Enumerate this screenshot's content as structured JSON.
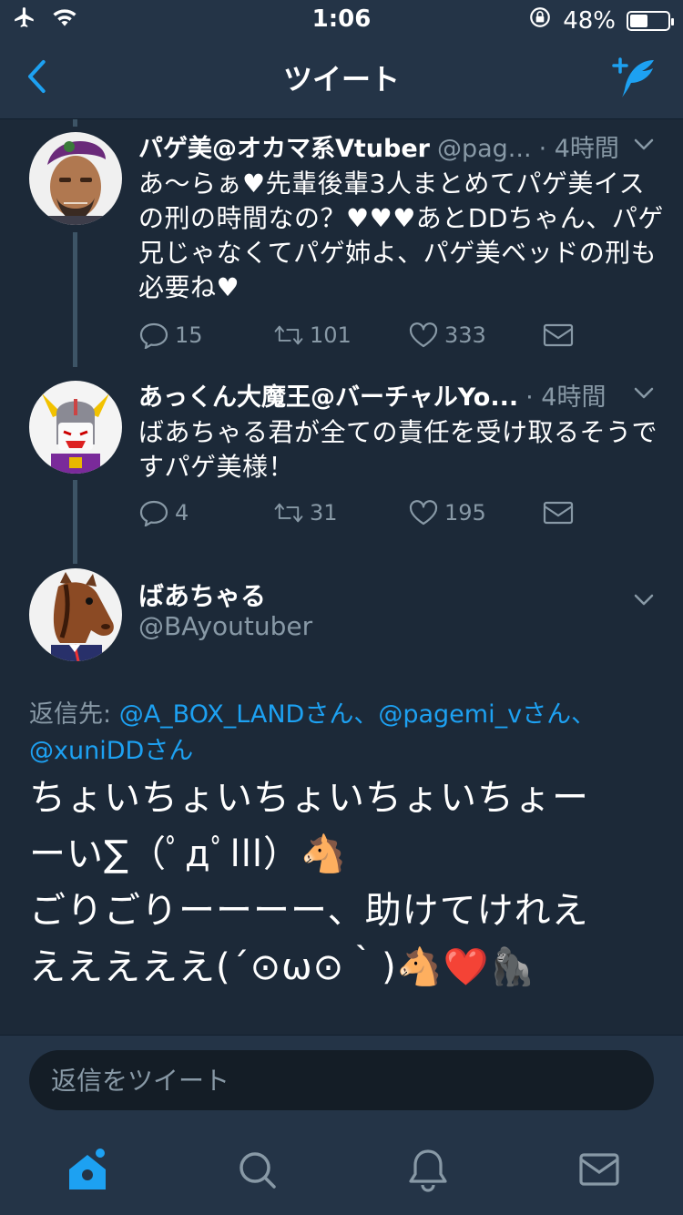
{
  "status_bar": {
    "time": "1:06",
    "battery": "48%",
    "battery_level": 0.48
  },
  "nav": {
    "title": "ツイート"
  },
  "tweets": [
    {
      "name": "パゲ美@オカマ系Vtuber",
      "handle": "@pag...",
      "time": "· 4時間",
      "text": "あ〜らぁ♥先輩後輩3人まとめてパゲ美イスの刑の時間なの？♥♥♥あとDDちゃん、パゲ兄じゃなくてパゲ姉よ、パゲ美ベッドの刑も必要ね♥",
      "replies": "15",
      "retweets": "101",
      "likes": "333"
    },
    {
      "name": "あっくん大魔王@バーチャルYo...",
      "handle": "",
      "time": "· 4時間",
      "text": "ばあちゃる君が全ての責任を受け取るそうですパゲ美様！",
      "replies": "4",
      "retweets": "31",
      "likes": "195"
    }
  ],
  "main_tweet": {
    "name": "ばあちゃる",
    "handle": "@BAyoutuber",
    "reply_to_label": "返信先: ",
    "mentions": [
      "@A_BOX_LANDさん、",
      "@pagemi_vさん、",
      "@xuniDDさん"
    ],
    "text": "ちょいちょいちょいちょいちょー\nーい∑（ﾟдﾟlll）🐴\nごりごりーーーー、助けてけれえ\nえええええ(´⊙ω⊙｀)🐴❤️🦍"
  },
  "reply_bar": {
    "placeholder": "返信をツイート"
  },
  "colors": {
    "background": "#1c2938",
    "bar": "#243447",
    "accent": "#1da1f2",
    "muted": "#8899a6"
  },
  "icons": [
    "back-icon",
    "compose-tweet-icon",
    "reply-icon",
    "retweet-icon",
    "like-icon",
    "share-dm-icon",
    "chevron-down-icon",
    "home-icon",
    "search-icon",
    "notifications-icon",
    "messages-icon"
  ]
}
